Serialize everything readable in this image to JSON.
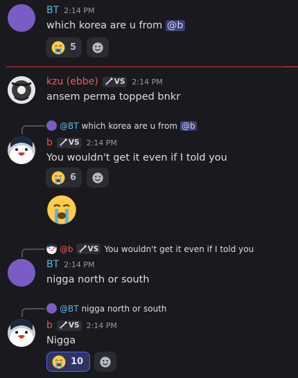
{
  "colors": {
    "bt_name": "#5bb7e8",
    "red_name": "#e85757",
    "kzu_name": "#ef5b5b",
    "mention_bg": "#3c4270",
    "purple_avatar": "#7b5cc4",
    "new_divider": "#c4303a"
  },
  "messages": [
    {
      "author": "BT",
      "time": "2:14 PM",
      "text_before": "which korea are u from",
      "mention": "@b",
      "reaction": {
        "emoji_icon": "loudly-crying-face",
        "count": "5"
      }
    },
    {
      "author": "kzu (ebbe)",
      "tag": "VS",
      "time": "2:14 PM",
      "text": "ansem perma topped bnkr"
    },
    {
      "reply": {
        "name": "@BT",
        "text": "which korea are u from",
        "mention": "@b"
      },
      "author": "b",
      "tag": "VS",
      "time": "2:14 PM",
      "text": "You wouldn't get it even if I told you",
      "reaction": {
        "emoji_icon": "loudly-crying-face",
        "count": "6"
      },
      "big_emoji_icon": "loudly-crying-face"
    },
    {
      "reply": {
        "name": "@b",
        "tag": "VS",
        "text": "You wouldn't get it even if I told you"
      },
      "author": "BT",
      "time": "2:14 PM",
      "text": "nigga north or south"
    },
    {
      "reply": {
        "name": "@BT",
        "text": "nigga north or south"
      },
      "author": "b",
      "tag": "VS",
      "time": "2:14 PM",
      "text": "Nigga",
      "reaction": {
        "emoji_icon": "loudly-crying-face",
        "count": "10",
        "active": true
      }
    }
  ]
}
